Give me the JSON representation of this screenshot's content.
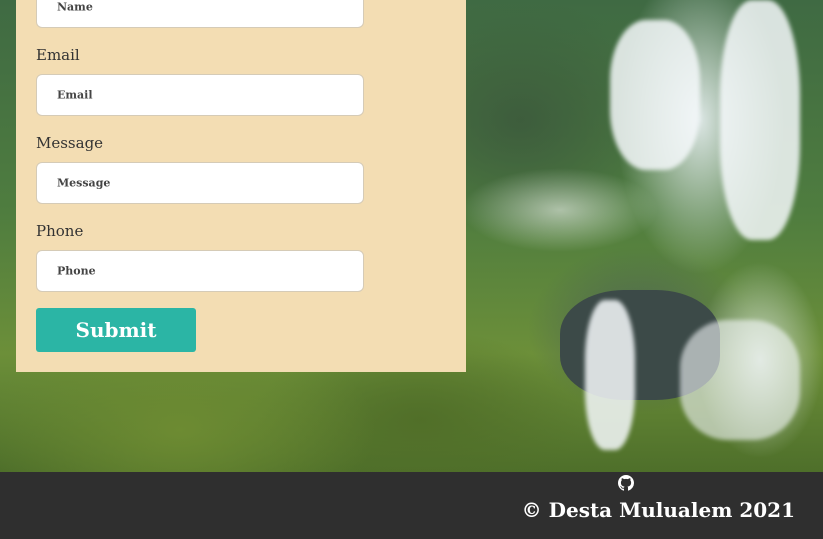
{
  "form": {
    "name": {
      "placeholder": "Name"
    },
    "email": {
      "label": "Email",
      "placeholder": "Email"
    },
    "message": {
      "label": "Message",
      "placeholder": "Message"
    },
    "phone": {
      "label": "Phone",
      "placeholder": "Phone"
    },
    "submit_label": "Submit"
  },
  "footer": {
    "github_icon": "github-icon",
    "copyright": "© Desta Mulualem 2021"
  },
  "colors": {
    "form_background": "#f3ddb3",
    "button": "#2bb5a5",
    "footer": "#2f2f2f"
  }
}
